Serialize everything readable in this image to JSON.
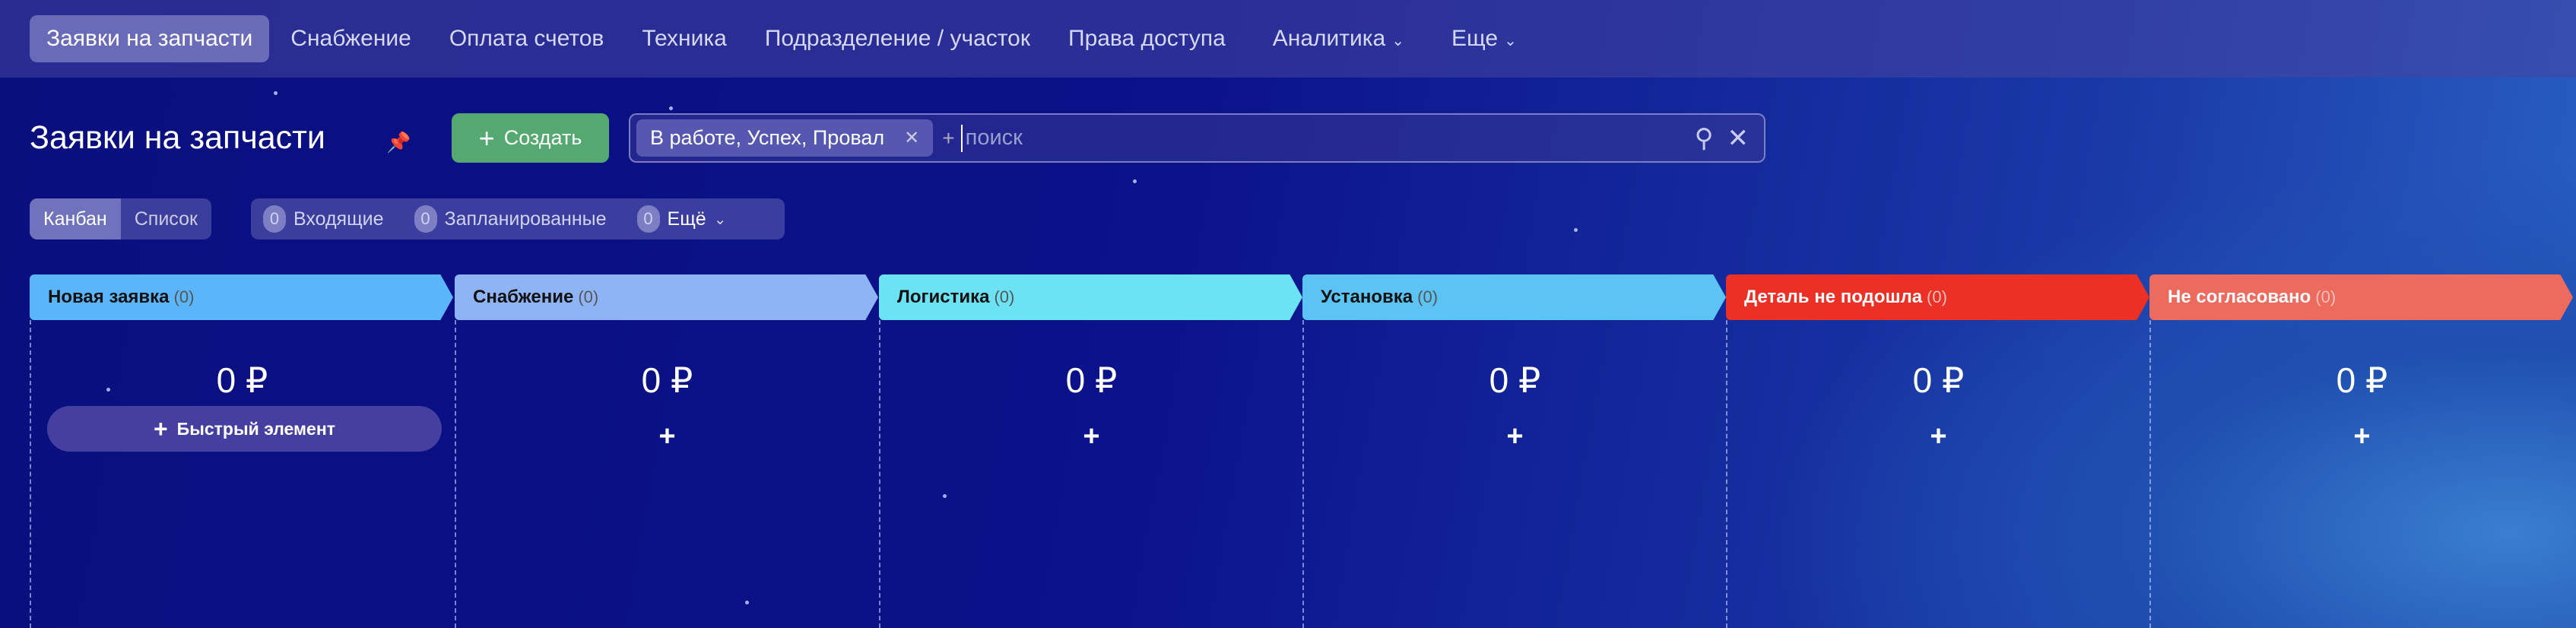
{
  "nav": {
    "items": [
      {
        "label": "Заявки на запчасти",
        "active": true
      },
      {
        "label": "Снабжение"
      },
      {
        "label": "Оплата счетов"
      },
      {
        "label": "Техника"
      },
      {
        "label": "Подразделение / участок"
      },
      {
        "label": "Права доступа"
      },
      {
        "label": "Аналитика",
        "dropdown": true
      },
      {
        "label": "Еще",
        "dropdown": true
      }
    ]
  },
  "header": {
    "title": "Заявки на запчасти",
    "create_label": "Создать"
  },
  "search": {
    "filter_chip": "В работе, Успех, Провал",
    "placeholder": "поиск"
  },
  "views": {
    "kanban": "Канбан",
    "list": "Список"
  },
  "counters": [
    {
      "count": "0",
      "label": "Входящие"
    },
    {
      "count": "0",
      "label": "Запланированные"
    },
    {
      "count": "0",
      "label": "Ещё"
    }
  ],
  "columns": [
    {
      "name": "Новая заявка",
      "count": "(0)",
      "sum": "0 ₽",
      "color": "#5bb5f9"
    },
    {
      "name": "Снабжение",
      "count": "(0)",
      "sum": "0 ₽",
      "color": "#8fb4f5"
    },
    {
      "name": "Логистика",
      "count": "(0)",
      "sum": "0 ₽",
      "color": "#6be3f5"
    },
    {
      "name": "Установка",
      "count": "(0)",
      "sum": "0 ₽",
      "color": "#5bc4f4"
    },
    {
      "name": "Деталь не подошла",
      "count": "(0)",
      "sum": "0 ₽",
      "color": "#ec3026"
    },
    {
      "name": "Не согласовано",
      "count": "(0)",
      "sum": "0 ₽",
      "color": "#ec6a5e"
    }
  ],
  "quick_add_label": "Быстрый элемент"
}
